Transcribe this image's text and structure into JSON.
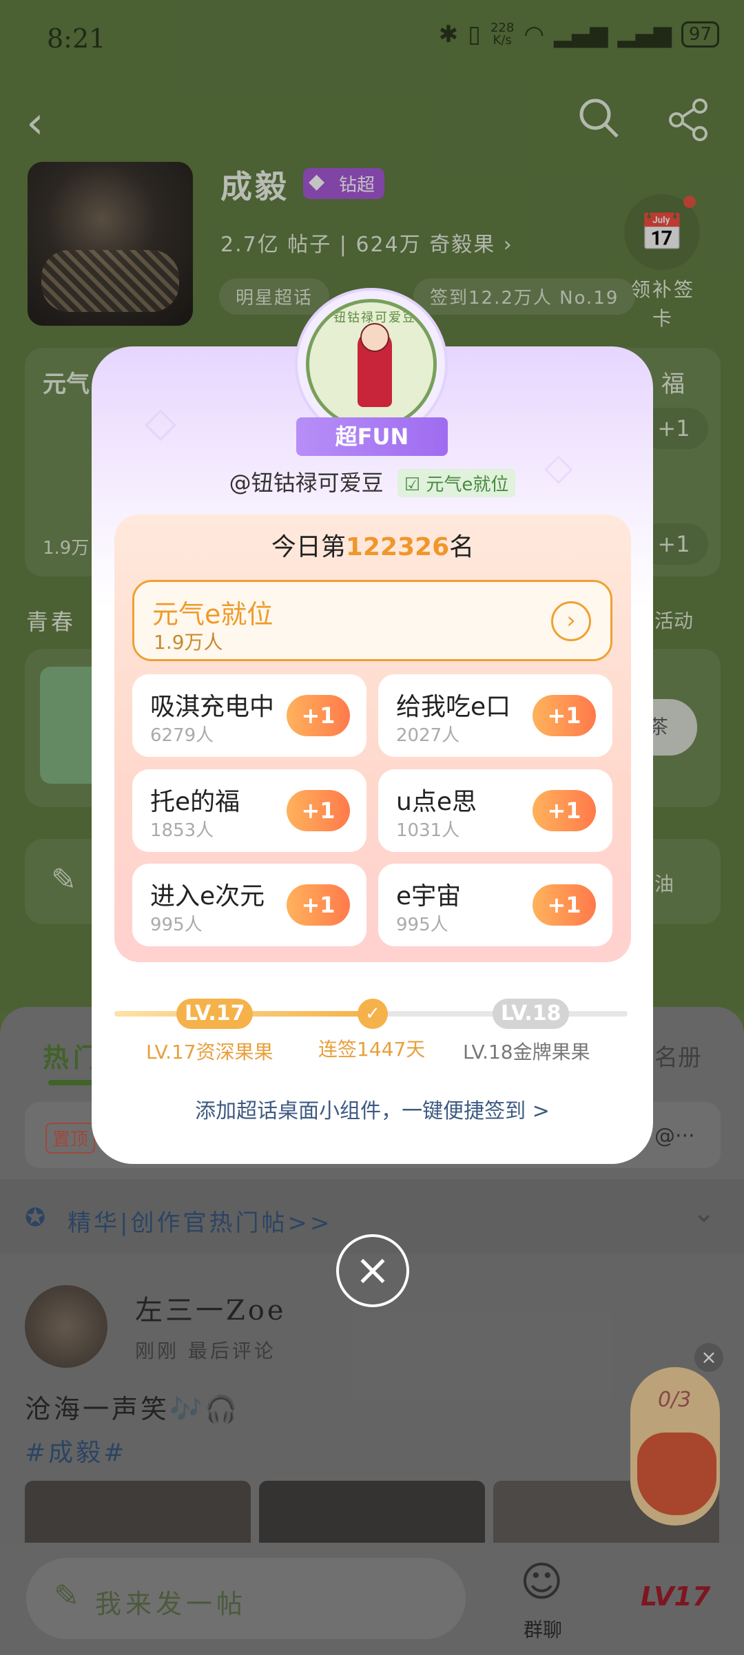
{
  "status_bar": {
    "time": "8:21",
    "net_speed_top": "228",
    "net_speed_unit": "K/s",
    "battery": "97"
  },
  "header": {
    "title": "成毅",
    "badge": "钻超",
    "posts_count": "2.7亿",
    "posts_label": "帖子",
    "fruit_count": "624万",
    "fruit_label": "奇毅果",
    "chip_left": "明星超话",
    "chip_right": "签到12.2万人 No.19",
    "checkin_label": "领补签卡"
  },
  "background": {
    "card_title": "元气",
    "card_right": "福",
    "card_sub": "1.9万",
    "youth_label": "青春",
    "activity_link": "活动",
    "tea_btn": "茶",
    "interest_right": "油",
    "tab_hot": "热门",
    "tab_right": "名册",
    "pin_tag": "置顶",
    "pin_right": "@···",
    "featured": "精华|创作官热门帖>>",
    "poster_name": "左三一Zoe",
    "poster_meta": "刚刚 最后评论",
    "post_text": "沧海一声笑🎶🎧",
    "post_tag": "#成毅#",
    "compose": "我来发一帖",
    "nav_group": "群聊",
    "nav_level": "LV17",
    "gift_counter": "0/3"
  },
  "modal": {
    "seal_text": "钮钴禄可爱豆",
    "ribbon": "超FUN",
    "username": "@钮钴禄可爱豆",
    "user_tag": "元气e就位",
    "rank_prefix": "今日第",
    "rank_number": "122326",
    "rank_suffix": "名",
    "main_option": {
      "name": "元气e就位",
      "count": "1.9万人"
    },
    "options": [
      {
        "name": "吸淇充电中",
        "count": "6279人",
        "plus": "+1"
      },
      {
        "name": "给我吃e口",
        "count": "2027人",
        "plus": "+1"
      },
      {
        "name": "托e的福",
        "count": "1853人",
        "plus": "+1"
      },
      {
        "name": "u点e思",
        "count": "1031人",
        "plus": "+1"
      },
      {
        "name": "进入e次元",
        "count": "995人",
        "plus": "+1"
      },
      {
        "name": "e宇宙",
        "count": "995人",
        "plus": "+1"
      }
    ],
    "level_current": "LV.17",
    "level_next": "LV.18",
    "level_current_label": "LV.17资深果果",
    "streak_label": "连签1447天",
    "level_next_label": "LV.18金牌果果",
    "progress_fraction": 0.5,
    "widget_link": "添加超话桌面小组件，一键便捷签到 >",
    "close": "×"
  }
}
